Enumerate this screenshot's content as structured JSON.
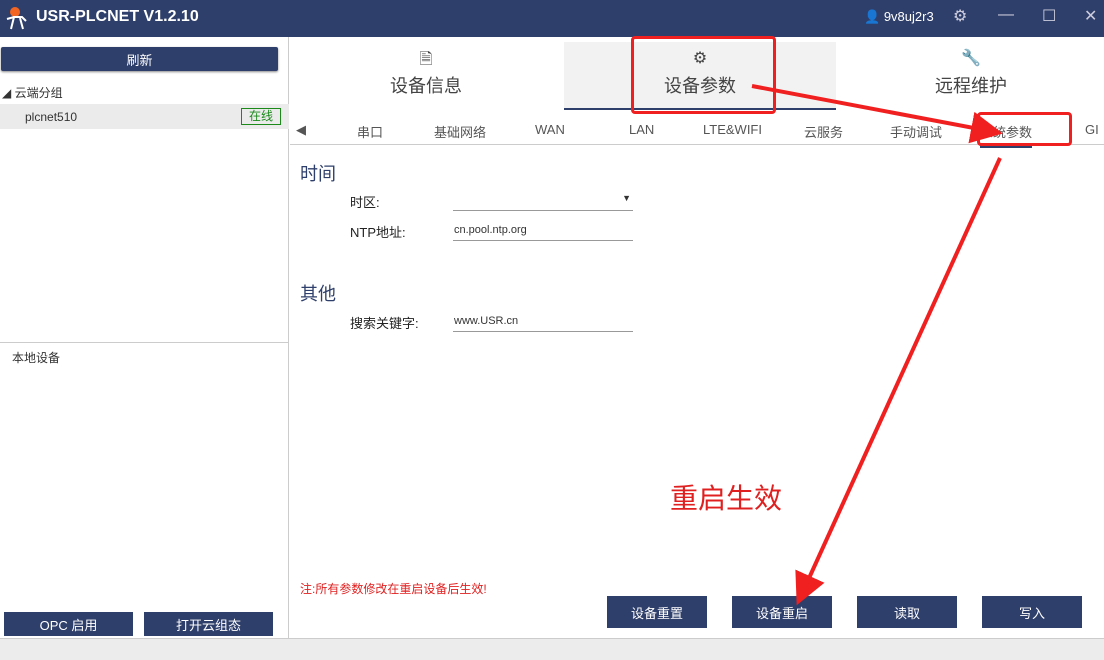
{
  "window": {
    "title": "USR-PLCNET V1.2.10",
    "user": "9v8uj2r3"
  },
  "sidebar": {
    "refresh": "刷新",
    "group": "云端分组",
    "device": {
      "name": "plcnet510",
      "status": "在线"
    },
    "local": "本地设备",
    "opc_button": "OPC 启用",
    "cloud_button": "打开云组态"
  },
  "top_tabs": [
    "设备信息",
    "设备参数",
    "远程维护"
  ],
  "sub_tabs": [
    "串口",
    "基础网络",
    "WAN",
    "LAN",
    "LTE&WIFI",
    "云服务",
    "手动调试",
    "系统参数",
    "GI"
  ],
  "form": {
    "time_section": "时间",
    "timezone_label": "时区:",
    "timezone_value": "",
    "ntp_label": "NTP地址:",
    "ntp_value": "cn.pool.ntp.org",
    "other_section": "其他",
    "keyword_label": "搜索关键字:",
    "keyword_value": "www.USR.cn"
  },
  "note": "注:所有参数修改在重启设备后生效!",
  "annotation": "重启生效",
  "buttons": {
    "reset": "设备重置",
    "restart": "设备重启",
    "read": "读取",
    "write": "写入"
  },
  "colors": {
    "primary": "#2f3f6b",
    "annotation": "#f02020",
    "online": "#1b8a1b"
  }
}
